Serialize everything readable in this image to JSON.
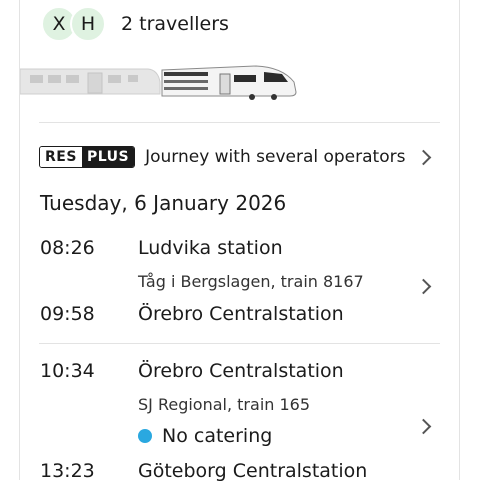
{
  "travellers": {
    "avatars": [
      "X",
      "H"
    ],
    "label": "2 travellers"
  },
  "journey": {
    "badge_res": "RES",
    "badge_plus": "PLUS",
    "operators_text": "Journey with several operators",
    "date": "Tuesday, 6 January 2026"
  },
  "legs": [
    {
      "depart_time": "08:26",
      "depart_station": "Ludvika station",
      "train": "Tåg i Bergslagen, train 8167",
      "arrive_time": "09:58",
      "arrive_station": "Örebro Centralstation"
    },
    {
      "depart_time": "10:34",
      "depart_station": "Örebro Centralstation",
      "train": "SJ Regional, train 165",
      "catering": "No catering",
      "arrive_time": "13:23",
      "arrive_station": "Göteborg Centralstation"
    }
  ],
  "colors": {
    "avatar_bg": "#dff2e1",
    "catering_dot": "#2aa8e0",
    "divider": "#e3e3e3"
  }
}
